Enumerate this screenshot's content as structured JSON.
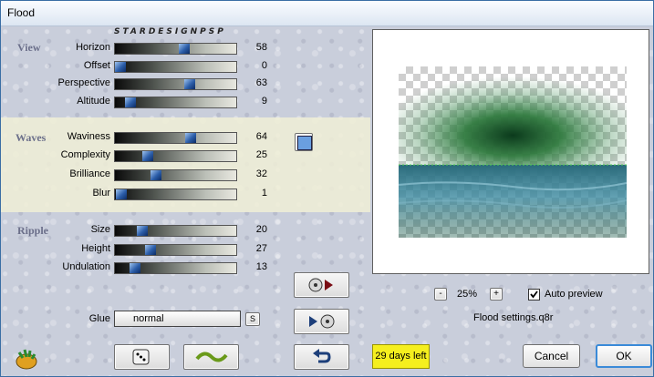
{
  "window": {
    "title": "Flood"
  },
  "watermark": "STARDESIGNPSP",
  "sections": {
    "view": "View",
    "waves": "Waves",
    "ripple": "Ripple"
  },
  "sliders": [
    {
      "label": "Horizon",
      "value": "58",
      "fraction": 0.58
    },
    {
      "label": "Offset",
      "value": "0",
      "fraction": 0.0
    },
    {
      "label": "Perspective",
      "value": "63",
      "fraction": 0.63
    },
    {
      "label": "Altitude",
      "value": "9",
      "fraction": 0.09
    },
    {
      "label": "Waviness",
      "value": "64",
      "fraction": 0.64
    },
    {
      "label": "Complexity",
      "value": "25",
      "fraction": 0.25
    },
    {
      "label": "Brilliance",
      "value": "32",
      "fraction": 0.32
    },
    {
      "label": "Blur",
      "value": "1",
      "fraction": 0.01
    },
    {
      "label": "Size",
      "value": "20",
      "fraction": 0.2
    },
    {
      "label": "Height",
      "value": "27",
      "fraction": 0.27
    },
    {
      "label": "Undulation",
      "value": "13",
      "fraction": 0.13
    }
  ],
  "color_swatch": "#6a9fe0",
  "glue": {
    "label": "Glue",
    "value": "normal",
    "s_label": "S"
  },
  "zoom": {
    "minus": "-",
    "value": "25%",
    "plus": "+"
  },
  "auto_preview": {
    "label": "Auto preview",
    "checked": true
  },
  "settings_file": "Flood settings.q8r",
  "trial": "29 days left",
  "buttons": {
    "cancel": "Cancel",
    "ok": "OK"
  },
  "icons": [
    "logo-icon",
    "dice-icon",
    "wave-icon",
    "undo-icon",
    "load-preset-icon",
    "save-preset-icon"
  ]
}
